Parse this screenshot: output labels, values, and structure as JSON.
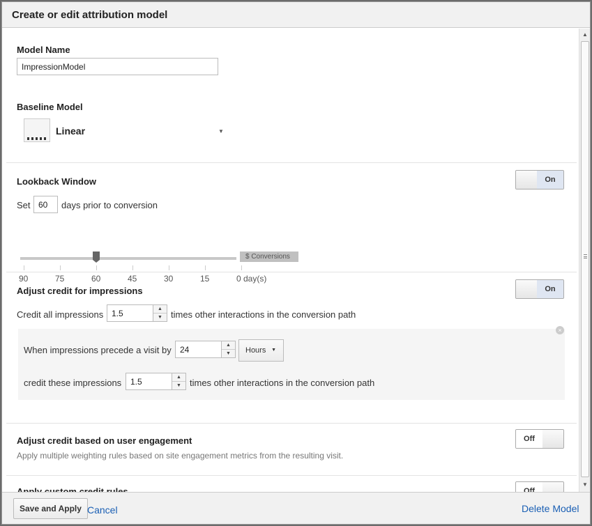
{
  "dialog": {
    "title": "Create or edit attribution model"
  },
  "model_name": {
    "label": "Model Name",
    "value": "ImpressionModel"
  },
  "baseline": {
    "label": "Baseline Model",
    "selected": "Linear",
    "icon": "linear-model-icon"
  },
  "lookback": {
    "label": "Lookback Window",
    "toggle": "On",
    "prefix": "Set",
    "days": "60",
    "suffix": "days prior to conversion",
    "slider_value_days": 60,
    "slider_tag": "$ Conversions",
    "ticks": [
      "90",
      "75",
      "60",
      "45",
      "30",
      "15",
      "0 day(s)"
    ]
  },
  "impressions": {
    "label": "Adjust credit for impressions",
    "toggle": "On",
    "credit_prefix": "Credit all impressions",
    "credit_value": "1.5",
    "credit_suffix": "times other interactions in the conversion path",
    "rule": {
      "precede_prefix": "When impressions precede a visit by",
      "precede_value": "24",
      "unit": "Hours",
      "credit_prefix": "credit these impressions",
      "credit_value": "1.5",
      "credit_suffix": "times other interactions in the conversion path"
    }
  },
  "engagement": {
    "label": "Adjust credit based on user engagement",
    "toggle": "Off",
    "description": "Apply multiple weighting rules based on site engagement metrics from the resulting visit."
  },
  "custom_rules": {
    "label": "Apply custom credit rules",
    "toggle": "Off"
  },
  "footer": {
    "save_label": "Save and Apply",
    "cancel_label": "Cancel",
    "delete_label": "Delete Model"
  }
}
